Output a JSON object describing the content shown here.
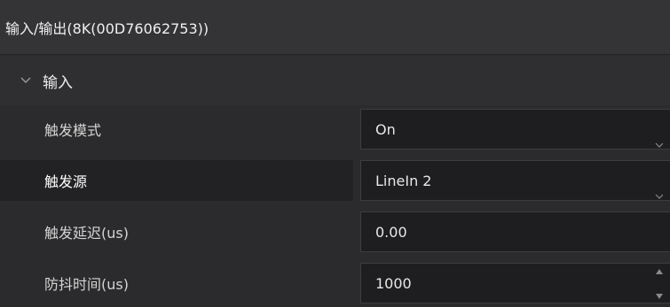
{
  "panel": {
    "title": "输入/输出(8K(00D76062753))"
  },
  "section": {
    "title": "输入",
    "expanded": true
  },
  "rows": [
    {
      "label": "触发模式",
      "value": "On",
      "control": "dropdown"
    },
    {
      "label": "触发源",
      "value": "LineIn 2",
      "control": "dropdown",
      "selected": true
    },
    {
      "label": "触发延迟(us)",
      "value": "0.00",
      "control": "spinbox"
    },
    {
      "label": "防抖时间(us)",
      "value": "1000",
      "control": "spinbox"
    }
  ],
  "icons": {
    "section_toggle": "chevron-down-icon",
    "dropdown": "dropdown-arrow-icon",
    "spin": "spin-arrows-icon"
  },
  "colors": {
    "background": "#2b2b2d",
    "header": "#343437",
    "selected_row": "#222224",
    "value_field": "#1e1e20"
  }
}
